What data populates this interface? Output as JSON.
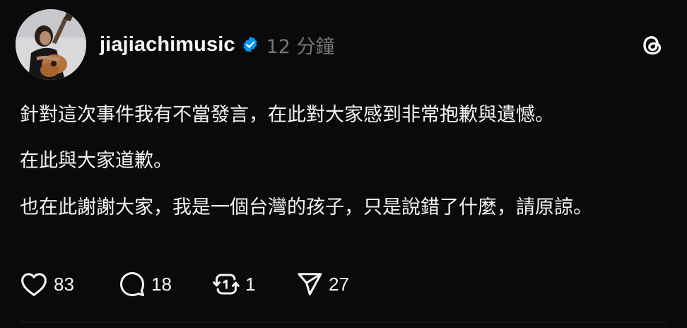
{
  "post": {
    "username": "jiajiachimusic",
    "timestamp": "12 分鐘",
    "paragraphs": [
      "針對這次事件我有不當發言，在此對大家感到非常抱歉與遺憾。",
      "在此與大家道歉。",
      "也在此謝謝大家，我是一個台灣的孩子，只是說錯了什麼，請原諒。"
    ]
  },
  "actions": {
    "likes": "83",
    "replies": "18",
    "reposts": "1",
    "shares": "27"
  },
  "icons": {
    "verified": "verified-badge-icon",
    "threads": "threads-logo-icon",
    "like": "heart-icon",
    "reply": "comment-bubble-icon",
    "repost": "repost-icon",
    "share": "send-icon"
  },
  "colors": {
    "background": "#0a0a0a",
    "text": "#f3f5f7",
    "muted": "#77777c",
    "verified": "#0095f6"
  }
}
